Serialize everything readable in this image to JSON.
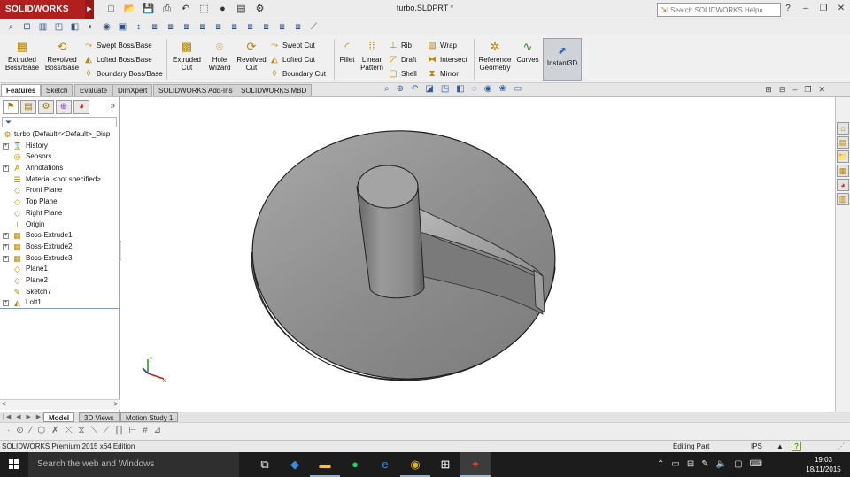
{
  "app": {
    "logo_text": "SOLIDWORKS",
    "document_title": "turbo.SLDPRT *",
    "help_search_placeholder": "Search SOLIDWORKS Help",
    "quick_access_icons": [
      "new-document-icon",
      "open-icon",
      "save-icon",
      "print-icon",
      "undo-icon",
      "select-icon",
      "rebuild-icon",
      "file-properties-icon",
      "options-icon"
    ]
  },
  "ribbon": {
    "extruded_boss": "Extruded Boss/Base",
    "revolved_boss": "Revolved Boss/Base",
    "swept_boss": "Swept Boss/Base",
    "lofted_boss": "Lofted Boss/Base",
    "boundary_boss": "Boundary Boss/Base",
    "extruded_cut": "Extruded Cut",
    "hole_wizard": "Hole Wizard",
    "revolved_cut": "Revolved Cut",
    "swept_cut": "Swept Cut",
    "lofted_cut": "Lofted Cut",
    "boundary_cut": "Boundary Cut",
    "fillet": "Fillet",
    "linear_pattern": "Linear Pattern",
    "rib": "Rib",
    "draft": "Draft",
    "shell": "Shell",
    "wrap": "Wrap",
    "intersect": "Intersect",
    "mirror": "Mirror",
    "reference_geometry": "Reference Geometry",
    "curves": "Curves",
    "instant3d": "Instant3D"
  },
  "tabs": [
    "Features",
    "Sketch",
    "Evaluate",
    "DimXpert",
    "SOLIDWORKS Add-Ins",
    "SOLIDWORKS MBD"
  ],
  "active_tab": "Features",
  "feature_tree": {
    "root": "turbo  (Default<<Default>_Disp",
    "items": [
      {
        "label": "History",
        "icon": "history-folder-icon",
        "expandable": true
      },
      {
        "label": "Sensors",
        "icon": "sensors-icon",
        "expandable": false
      },
      {
        "label": "Annotations",
        "icon": "annotations-icon",
        "expandable": true
      },
      {
        "label": "Material <not specified>",
        "icon": "material-icon",
        "expandable": false
      },
      {
        "label": "Front Plane",
        "icon": "plane-icon",
        "expandable": false
      },
      {
        "label": "Top Plane",
        "icon": "plane-icon",
        "expandable": false
      },
      {
        "label": "Right Plane",
        "icon": "plane-icon",
        "expandable": false
      },
      {
        "label": "Origin",
        "icon": "origin-icon",
        "expandable": false
      },
      {
        "label": "Boss-Extrude1",
        "icon": "boss-extrude-icon",
        "expandable": true
      },
      {
        "label": "Boss-Extrude2",
        "icon": "boss-extrude-icon",
        "expandable": true
      },
      {
        "label": "Boss-Extrude3",
        "icon": "boss-extrude-icon",
        "expandable": true
      },
      {
        "label": "Plane1",
        "icon": "plane-icon",
        "expandable": false
      },
      {
        "label": "Plane2",
        "icon": "plane-icon",
        "expandable": false
      },
      {
        "label": "Sketch7",
        "icon": "sketch-icon",
        "expandable": false
      },
      {
        "label": "Loft1",
        "icon": "loft-icon",
        "expandable": true
      }
    ]
  },
  "model_tabs": [
    "Model",
    "3D Views",
    "Motion Study 1"
  ],
  "active_model_tab": "Model",
  "status": {
    "edition": "SOLIDWORKS Premium 2015 x64 Edition",
    "mode": "Editing Part",
    "units": "IPS"
  },
  "taskbar": {
    "search_placeholder": "Search the web and Windows",
    "time": "19:03",
    "date": "18/11/2015"
  },
  "colors": {
    "brand_red": "#b21f1f",
    "model_fill": "#8f8f8f",
    "model_dark": "#6e6e6e",
    "taskbar_bg": "#1c1c1c"
  }
}
